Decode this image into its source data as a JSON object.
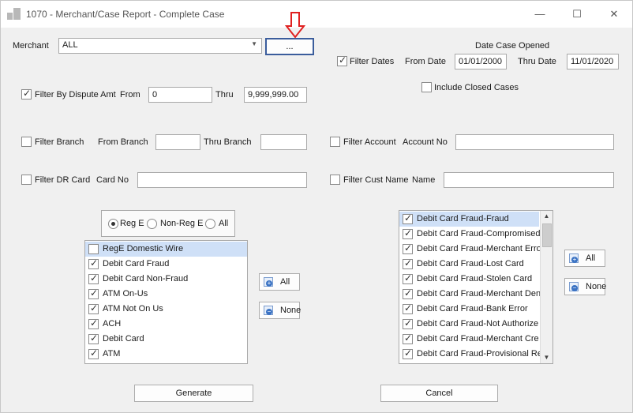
{
  "window": {
    "title": "1070 - Merchant/Case Report - Complete Case",
    "controls": {
      "minimize": "—",
      "maximize": "☐",
      "close": "✕"
    }
  },
  "merchant": {
    "label": "Merchant",
    "value": "ALL",
    "browse_label": "..."
  },
  "date_case_opened": {
    "heading": "Date Case Opened",
    "filter_label": "Filter Dates",
    "filter_checked": true,
    "from_label": "From Date",
    "from_value": "01/01/2000",
    "thru_label": "Thru Date",
    "thru_value": "11/01/2020"
  },
  "include_closed": {
    "label": "Include Closed Cases",
    "checked": false
  },
  "dispute_amt": {
    "label": "Filter By Dispute Amt",
    "checked": true,
    "from_label": "From",
    "from_value": "0",
    "thru_label": "Thru",
    "thru_value": "9,999,999.00"
  },
  "branch": {
    "label": "Filter Branch",
    "checked": false,
    "from_label": "From Branch",
    "from_value": "",
    "thru_label": "Thru Branch",
    "thru_value": ""
  },
  "account": {
    "label": "Filter Account",
    "checked": false,
    "field_label": "Account No",
    "value": ""
  },
  "dr_card": {
    "label": "Filter DR Card",
    "checked": false,
    "field_label": "Card No",
    "value": ""
  },
  "cust_name": {
    "label": "Filter Cust Name",
    "checked": false,
    "field_label": "Name",
    "value": ""
  },
  "reg_type": {
    "options": [
      {
        "label": "Reg E",
        "checked": true
      },
      {
        "label": "Non-Reg E",
        "checked": false
      },
      {
        "label": "All",
        "checked": false
      }
    ]
  },
  "left_list": {
    "items": [
      {
        "label": "RegE Domestic Wire",
        "checked": false,
        "selected": true
      },
      {
        "label": "Debit Card Fraud",
        "checked": true,
        "selected": false
      },
      {
        "label": "Debit Card Non-Fraud",
        "checked": true,
        "selected": false
      },
      {
        "label": "ATM On-Us",
        "checked": true,
        "selected": false
      },
      {
        "label": "ATM Not On Us",
        "checked": true,
        "selected": false
      },
      {
        "label": "ACH",
        "checked": true,
        "selected": false
      },
      {
        "label": "Debit Card",
        "checked": true,
        "selected": false
      },
      {
        "label": "ATM",
        "checked": true,
        "selected": false
      }
    ],
    "all_label": "All",
    "none_label": "None"
  },
  "right_list": {
    "items": [
      {
        "label": "Debit Card Fraud-Fraud",
        "checked": true,
        "selected": true
      },
      {
        "label": "Debit Card Fraud-Compromised",
        "checked": true,
        "selected": false
      },
      {
        "label": "Debit Card Fraud-Merchant Erro",
        "checked": true,
        "selected": false
      },
      {
        "label": "Debit Card Fraud-Lost Card",
        "checked": true,
        "selected": false
      },
      {
        "label": "Debit Card Fraud-Stolen Card",
        "checked": true,
        "selected": false
      },
      {
        "label": "Debit Card Fraud-Merchant Den",
        "checked": true,
        "selected": false
      },
      {
        "label": "Debit Card Fraud-Bank Error",
        "checked": true,
        "selected": false
      },
      {
        "label": "Debit Card Fraud-Not Authorize",
        "checked": true,
        "selected": false
      },
      {
        "label": "Debit Card Fraud-Merchant Cre",
        "checked": true,
        "selected": false
      },
      {
        "label": "Debit Card Fraud-Provisional Re",
        "checked": true,
        "selected": false
      }
    ],
    "all_label": "All",
    "none_label": "None"
  },
  "actions": {
    "generate_label": "Generate",
    "cancel_label": "Cancel"
  },
  "colors": {
    "annotation_arrow": "#e02020",
    "selection": "#cfe0f7",
    "focus_border": "#3b5d9c"
  }
}
